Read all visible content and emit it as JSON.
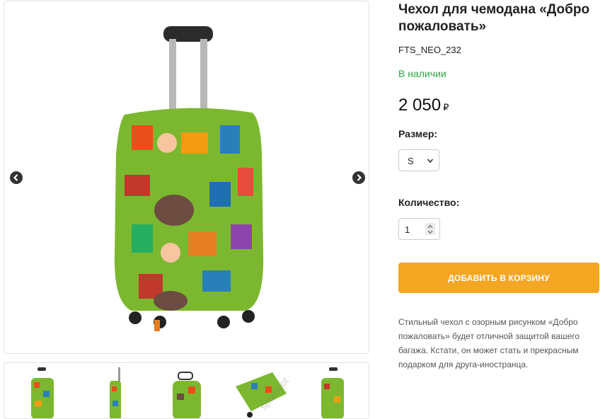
{
  "product": {
    "title": "Чехол для чемодана «Добро пожаловать»",
    "sku": "FTS_NEO_232",
    "availability": "В наличии",
    "availability_color": "#28a745",
    "price": "2 050",
    "currency": "₽"
  },
  "options": {
    "size_label": "Размер:",
    "size_value": "S",
    "quantity_label": "Количество:",
    "quantity_value": "1"
  },
  "cart": {
    "button_label": "Добавить в корзину",
    "button_color": "#f5a623"
  },
  "description": "Стильный чехол с озорным рисунком «Добро пожаловать» будет отличной защитой вашего багажа. Кстати, он может стать и прекрасным подарком для друга-иностранца.",
  "gallery": {
    "prev_icon": "chevron-left-circle-icon",
    "next_icon": "chevron-right-circle-icon",
    "thumbnail_count": 5,
    "watermark": "sportfoot"
  }
}
